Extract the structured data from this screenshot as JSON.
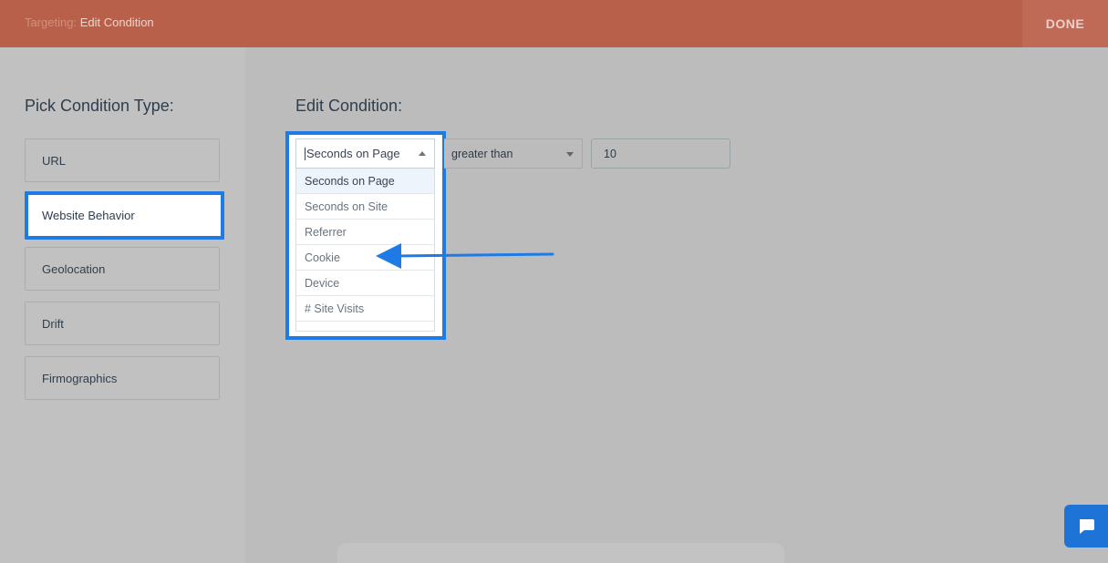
{
  "header": {
    "breadcrumb_prefix": "Targeting:",
    "breadcrumb_current": "Edit Condition",
    "done_label": "DONE"
  },
  "left_panel": {
    "title": "Pick Condition Type:",
    "items": [
      {
        "label": "URL",
        "active": false
      },
      {
        "label": "Website Behavior",
        "active": true
      },
      {
        "label": "Geolocation",
        "active": false
      },
      {
        "label": "Drift",
        "active": false
      },
      {
        "label": "Firmographics",
        "active": false
      }
    ]
  },
  "edit": {
    "title": "Edit Condition:",
    "attribute_select": {
      "value": "Seconds on Page",
      "options": [
        "Seconds on Page",
        "Seconds on Site",
        "Referrer",
        "Cookie",
        "Device",
        "# Site Visits"
      ]
    },
    "operator_select": {
      "value": "greater than"
    },
    "value_input": {
      "value": "10"
    }
  },
  "colors": {
    "header": "#b9604b",
    "highlight": "#1e7be6",
    "chat_button": "#1e73d6"
  },
  "icons": {
    "annotation_arrow": "arrow-left-icon",
    "chat": "chat-bubble-icon"
  }
}
